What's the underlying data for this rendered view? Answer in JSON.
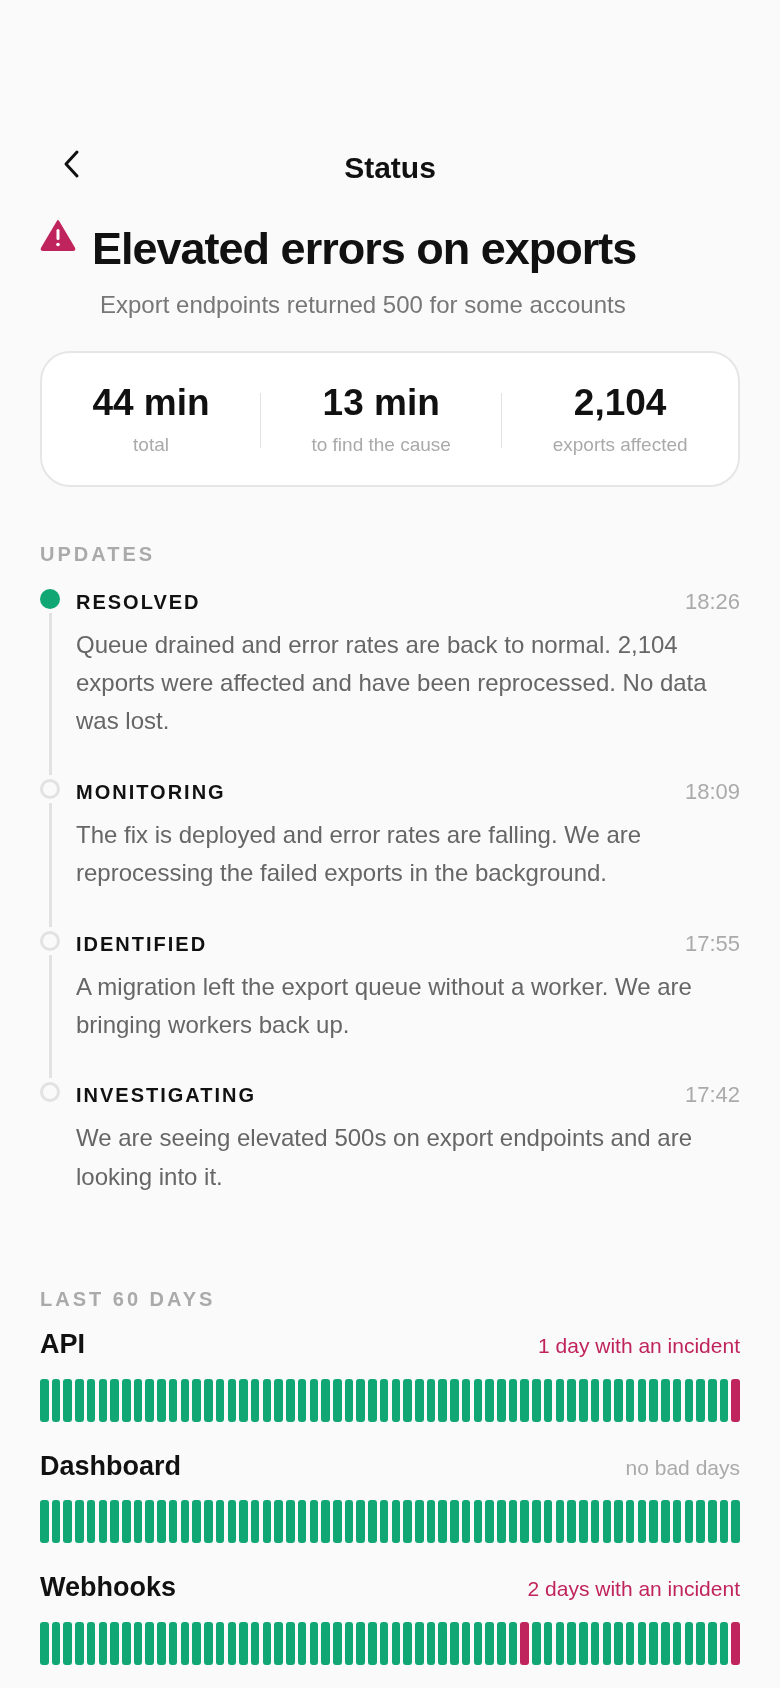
{
  "header": {
    "title": "Status"
  },
  "incident": {
    "title": "Elevated errors on exports",
    "subtitle": "Export endpoints returned 500 for some accounts"
  },
  "stats": [
    {
      "value": "44 min",
      "label": "total"
    },
    {
      "value": "13 min",
      "label": "to find the cause"
    },
    {
      "value": "2,104",
      "label": "exports affected"
    }
  ],
  "updates": {
    "heading": "UPDATES",
    "items": [
      {
        "status": "RESOLVED",
        "time": "18:26",
        "text": "Queue drained and error rates are back to normal. 2,104 exports were affected and have been reprocessed. No data was lost.",
        "selected": true
      },
      {
        "status": "MONITORING",
        "time": "18:09",
        "text": "The fix is deployed and error rates are falling. We are reprocessing the failed exports in the background.",
        "selected": false
      },
      {
        "status": "IDENTIFIED",
        "time": "17:55",
        "text": "A migration left the export queue without a worker. We are bringing workers back up.",
        "selected": false
      },
      {
        "status": "INVESTIGATING",
        "time": "17:42",
        "text": "We are seeing elevated 500s on export endpoints and are looking into it.",
        "selected": false
      }
    ]
  },
  "history": {
    "heading": "LAST 60 DAYS",
    "services": [
      {
        "name": "API",
        "summary": "1 day with an incident",
        "incident": true,
        "days": [
          false,
          false,
          false,
          false,
          false,
          false,
          false,
          false,
          false,
          false,
          false,
          false,
          false,
          false,
          false,
          false,
          false,
          false,
          false,
          false,
          false,
          false,
          false,
          false,
          false,
          false,
          false,
          false,
          false,
          false,
          false,
          false,
          false,
          false,
          false,
          false,
          false,
          false,
          false,
          false,
          false,
          false,
          false,
          false,
          false,
          false,
          false,
          false,
          false,
          false,
          false,
          false,
          false,
          false,
          false,
          false,
          false,
          false,
          false,
          true
        ]
      },
      {
        "name": "Dashboard",
        "summary": "no bad days",
        "incident": false,
        "days": [
          false,
          false,
          false,
          false,
          false,
          false,
          false,
          false,
          false,
          false,
          false,
          false,
          false,
          false,
          false,
          false,
          false,
          false,
          false,
          false,
          false,
          false,
          false,
          false,
          false,
          false,
          false,
          false,
          false,
          false,
          false,
          false,
          false,
          false,
          false,
          false,
          false,
          false,
          false,
          false,
          false,
          false,
          false,
          false,
          false,
          false,
          false,
          false,
          false,
          false,
          false,
          false,
          false,
          false,
          false,
          false,
          false,
          false,
          false,
          false
        ]
      },
      {
        "name": "Webhooks",
        "summary": "2 days with an incident",
        "incident": true,
        "days": [
          false,
          false,
          false,
          false,
          false,
          false,
          false,
          false,
          false,
          false,
          false,
          false,
          false,
          false,
          false,
          false,
          false,
          false,
          false,
          false,
          false,
          false,
          false,
          false,
          false,
          false,
          false,
          false,
          false,
          false,
          false,
          false,
          false,
          false,
          false,
          false,
          false,
          false,
          false,
          false,
          false,
          true,
          false,
          false,
          false,
          false,
          false,
          false,
          false,
          false,
          false,
          false,
          false,
          false,
          false,
          false,
          false,
          false,
          false,
          true
        ]
      }
    ]
  }
}
